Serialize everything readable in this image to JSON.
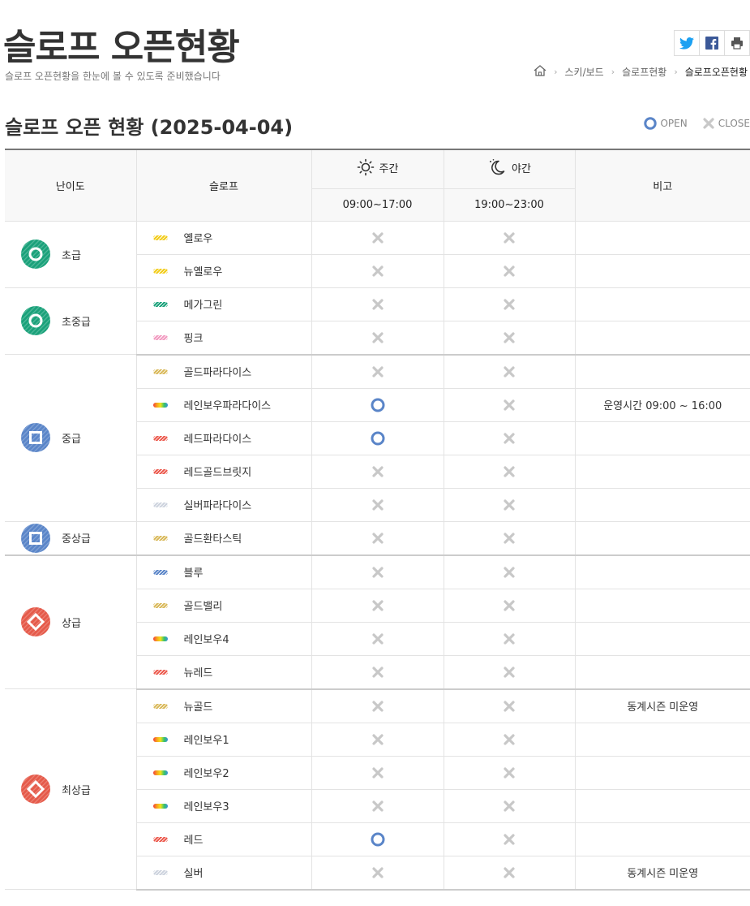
{
  "header": {
    "title": "슬로프 오픈현황",
    "subtitle": "슬로프 오픈현황을 한눈에 볼 수 있도록 준비했습니다",
    "share": [
      {
        "name": "twitter-icon",
        "color": "#1da1f2"
      },
      {
        "name": "facebook-icon",
        "color": "#3b5998"
      },
      {
        "name": "print-icon",
        "color": "#555555"
      }
    ],
    "breadcrumb": [
      "스키/보드",
      "슬로프현황",
      "슬로프오픈현황"
    ]
  },
  "section": {
    "title": "슬로프 오픈 현황 (2025-04-04)",
    "legend_open": "OPEN",
    "legend_close": "CLOSE"
  },
  "table": {
    "headers": {
      "difficulty": "난이도",
      "slope": "슬로프",
      "day": "주간",
      "night": "야간",
      "note": "비고",
      "day_time": "09:00~17:00",
      "night_time": "19:00~23:00"
    },
    "colors": {
      "open": "#5a85c8",
      "close": "#c8c8c8",
      "green": "#1aa17a",
      "blue": "#5a85c8",
      "red": "#e55a4a"
    },
    "groups": [
      {
        "difficulty": "초급",
        "icon": "circle",
        "color": "#1aa17a",
        "slopes": [
          {
            "name": "옐로우",
            "swatch": "#f2cc1a",
            "day": "close",
            "night": "close",
            "note": ""
          },
          {
            "name": "뉴옐로우",
            "swatch": "#f2cc1a",
            "day": "close",
            "night": "close",
            "note": ""
          }
        ]
      },
      {
        "difficulty": "초중급",
        "icon": "circle",
        "color": "#1aa17a",
        "slopes": [
          {
            "name": "메가그린",
            "swatch": "#1aa17a",
            "day": "close",
            "night": "close",
            "note": ""
          },
          {
            "name": "핑크",
            "swatch": "#f29ac0",
            "day": "close",
            "night": "close",
            "note": ""
          }
        ]
      },
      {
        "difficulty": "중급",
        "icon": "square",
        "color": "#5a85c8",
        "slopes": [
          {
            "name": "골드파라다이스",
            "swatch": "#d9b95a",
            "day": "close",
            "night": "close",
            "note": ""
          },
          {
            "name": "레인보우파라다이스",
            "swatch": "rainbow",
            "day": "open",
            "night": "close",
            "note": "운영시간 09:00 ~ 16:00"
          },
          {
            "name": "레드파라다이스",
            "swatch": "#ec5a4e",
            "day": "open",
            "night": "close",
            "note": ""
          },
          {
            "name": "레드골드브릿지",
            "swatch": "#ec5a4e",
            "day": "close",
            "night": "close",
            "note": ""
          },
          {
            "name": "실버파라다이스",
            "swatch": "#cdd3de",
            "day": "close",
            "night": "close",
            "note": ""
          }
        ]
      },
      {
        "difficulty": "중상급",
        "icon": "square",
        "color": "#5a85c8",
        "slopes": [
          {
            "name": "골드환타스틱",
            "swatch": "#d9b95a",
            "day": "close",
            "night": "close",
            "note": ""
          }
        ]
      },
      {
        "difficulty": "상급",
        "icon": "diamond",
        "color": "#e55a4a",
        "slopes": [
          {
            "name": "블루",
            "swatch": "#5a85c8",
            "day": "close",
            "night": "close",
            "note": ""
          },
          {
            "name": "골드밸리",
            "swatch": "#d9b95a",
            "day": "close",
            "night": "close",
            "note": ""
          },
          {
            "name": "레인보우4",
            "swatch": "rainbow",
            "day": "close",
            "night": "close",
            "note": ""
          },
          {
            "name": "뉴레드",
            "swatch": "#ec5a4e",
            "day": "close",
            "night": "close",
            "note": ""
          }
        ]
      },
      {
        "difficulty": "최상급",
        "icon": "diamond",
        "color": "#e55a4a",
        "slopes": [
          {
            "name": "뉴골드",
            "swatch": "#d9b95a",
            "day": "close",
            "night": "close",
            "note": "동계시즌 미운영"
          },
          {
            "name": "레인보우1",
            "swatch": "rainbow",
            "day": "close",
            "night": "close",
            "note": ""
          },
          {
            "name": "레인보우2",
            "swatch": "rainbow",
            "day": "close",
            "night": "close",
            "note": ""
          },
          {
            "name": "레인보우3",
            "swatch": "rainbow",
            "day": "close",
            "night": "close",
            "note": ""
          },
          {
            "name": "레드",
            "swatch": "#ec5a4e",
            "day": "open",
            "night": "close",
            "note": ""
          },
          {
            "name": "실버",
            "swatch": "#cdd3de",
            "day": "close",
            "night": "close",
            "note": "동계시즌 미운영"
          }
        ]
      }
    ]
  }
}
